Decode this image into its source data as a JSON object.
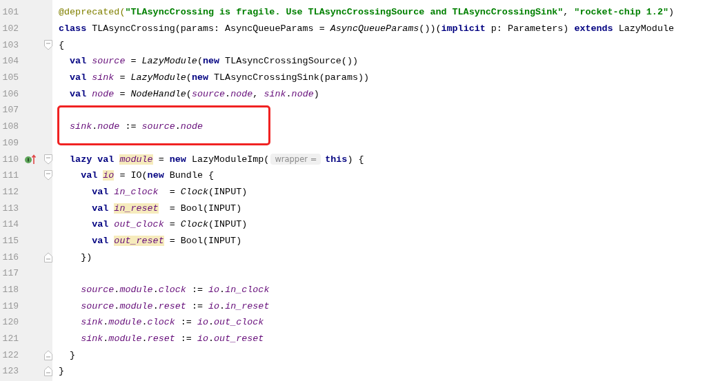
{
  "editor": {
    "lines": [
      {
        "number": "101",
        "tokens": [
          {
            "kind": "annotation",
            "text": "@deprecated("
          },
          {
            "kind": "string",
            "text": "\"TLAsyncCrossing is fragile. Use TLAsyncCrossingSource and TLAsyncCrossingSink\""
          },
          {
            "kind": "plain",
            "text": ", "
          },
          {
            "kind": "string",
            "text": "\"rocket-chip 1.2\""
          },
          {
            "kind": "plain",
            "text": ")"
          }
        ]
      },
      {
        "number": "102",
        "tokens": [
          {
            "kind": "keyword",
            "text": "class"
          },
          {
            "kind": "plain",
            "text": " TLAsyncCrossing(params: AsyncQueueParams = "
          },
          {
            "kind": "italic",
            "text": "AsyncQueueParams"
          },
          {
            "kind": "plain",
            "text": "())("
          },
          {
            "kind": "keyword",
            "text": "implicit"
          },
          {
            "kind": "plain",
            "text": " p: Parameters) "
          },
          {
            "kind": "keyword",
            "text": "extends"
          },
          {
            "kind": "plain",
            "text": " LazyModule"
          }
        ]
      },
      {
        "number": "103",
        "fold": {
          "kind": "start"
        },
        "tokens": [
          {
            "kind": "plain",
            "text": "{"
          }
        ]
      },
      {
        "number": "104",
        "tokens": [
          {
            "kind": "keyword",
            "text": "  val "
          },
          {
            "kind": "field",
            "text": "source"
          },
          {
            "kind": "plain",
            "text": " = "
          },
          {
            "kind": "italic",
            "text": "LazyModule"
          },
          {
            "kind": "plain",
            "text": "("
          },
          {
            "kind": "keyword",
            "text": "new"
          },
          {
            "kind": "plain",
            "text": " TLAsyncCrossingSource())"
          }
        ]
      },
      {
        "number": "105",
        "tokens": [
          {
            "kind": "keyword",
            "text": "  val "
          },
          {
            "kind": "field",
            "text": "sink"
          },
          {
            "kind": "plain",
            "text": " = "
          },
          {
            "kind": "italic",
            "text": "LazyModule"
          },
          {
            "kind": "plain",
            "text": "("
          },
          {
            "kind": "keyword",
            "text": "new"
          },
          {
            "kind": "plain",
            "text": " TLAsyncCrossingSink(params))"
          }
        ]
      },
      {
        "number": "106",
        "tokens": [
          {
            "kind": "keyword",
            "text": "  val "
          },
          {
            "kind": "field",
            "text": "node"
          },
          {
            "kind": "plain",
            "text": " = "
          },
          {
            "kind": "italic",
            "text": "NodeHandle"
          },
          {
            "kind": "plain",
            "text": "("
          },
          {
            "kind": "field",
            "text": "source"
          },
          {
            "kind": "plain",
            "text": "."
          },
          {
            "kind": "field",
            "text": "node"
          },
          {
            "kind": "plain",
            "text": ", "
          },
          {
            "kind": "field",
            "text": "sink"
          },
          {
            "kind": "plain",
            "text": "."
          },
          {
            "kind": "field",
            "text": "node"
          },
          {
            "kind": "plain",
            "text": ")"
          }
        ]
      },
      {
        "number": "107"
      },
      {
        "number": "108",
        "tokens": [
          {
            "kind": "field",
            "text": "  sink"
          },
          {
            "kind": "plain",
            "text": "."
          },
          {
            "kind": "field",
            "text": "node"
          },
          {
            "kind": "plain",
            "text": " := "
          },
          {
            "kind": "field",
            "text": "source"
          },
          {
            "kind": "plain",
            "text": "."
          },
          {
            "kind": "field",
            "text": "node"
          }
        ]
      },
      {
        "number": "109"
      },
      {
        "number": "110",
        "fold": {
          "kind": "start"
        },
        "gutter_mark": {
          "kind": "implements"
        },
        "tokens": [
          {
            "kind": "keyword",
            "text": "  lazy val "
          },
          {
            "kind": "field",
            "text": "module",
            "highlighted": true
          },
          {
            "kind": "plain",
            "text": " = "
          },
          {
            "kind": "keyword",
            "text": "new"
          },
          {
            "kind": "plain",
            "text": " LazyModuleImp("
          },
          {
            "kind": "hint",
            "text": "wrapper ="
          },
          {
            "kind": "keyword",
            "text": "this"
          },
          {
            "kind": "plain",
            "text": ") {"
          }
        ]
      },
      {
        "number": "111",
        "fold": {
          "kind": "start"
        },
        "tokens": [
          {
            "kind": "keyword",
            "text": "    val "
          },
          {
            "kind": "field",
            "text": "io",
            "highlighted": true
          },
          {
            "kind": "plain",
            "text": " = IO("
          },
          {
            "kind": "keyword",
            "text": "new"
          },
          {
            "kind": "plain",
            "text": " Bundle {"
          }
        ]
      },
      {
        "number": "112",
        "tokens": [
          {
            "kind": "keyword",
            "text": "      val "
          },
          {
            "kind": "field",
            "text": "in_clock"
          },
          {
            "kind": "plain",
            "text": "  = "
          },
          {
            "kind": "italic",
            "text": "Clock"
          },
          {
            "kind": "plain",
            "text": "(INPUT)"
          }
        ]
      },
      {
        "number": "113",
        "tokens": [
          {
            "kind": "keyword",
            "text": "      val "
          },
          {
            "kind": "field",
            "text": "in_reset",
            "highlighted": true
          },
          {
            "kind": "plain",
            "text": "  = Bool(INPUT)"
          }
        ]
      },
      {
        "number": "114",
        "tokens": [
          {
            "kind": "keyword",
            "text": "      val "
          },
          {
            "kind": "field",
            "text": "out_clock"
          },
          {
            "kind": "plain",
            "text": " = "
          },
          {
            "kind": "italic",
            "text": "Clock"
          },
          {
            "kind": "plain",
            "text": "(INPUT)"
          }
        ]
      },
      {
        "number": "115",
        "tokens": [
          {
            "kind": "keyword",
            "text": "      val "
          },
          {
            "kind": "field",
            "text": "out_reset",
            "highlighted": true
          },
          {
            "kind": "plain",
            "text": " = Bool(INPUT)"
          }
        ]
      },
      {
        "number": "116",
        "fold": {
          "kind": "end"
        },
        "tokens": [
          {
            "kind": "plain",
            "text": "    })"
          }
        ]
      },
      {
        "number": "117"
      },
      {
        "number": "118",
        "tokens": [
          {
            "kind": "field",
            "text": "    source"
          },
          {
            "kind": "plain",
            "text": "."
          },
          {
            "kind": "field",
            "text": "module"
          },
          {
            "kind": "plain",
            "text": "."
          },
          {
            "kind": "field",
            "text": "clock"
          },
          {
            "kind": "plain",
            "text": " := "
          },
          {
            "kind": "field",
            "text": "io"
          },
          {
            "kind": "plain",
            "text": "."
          },
          {
            "kind": "field",
            "text": "in_clock"
          }
        ]
      },
      {
        "number": "119",
        "tokens": [
          {
            "kind": "field",
            "text": "    source"
          },
          {
            "kind": "plain",
            "text": "."
          },
          {
            "kind": "field",
            "text": "module"
          },
          {
            "kind": "plain",
            "text": "."
          },
          {
            "kind": "field",
            "text": "reset"
          },
          {
            "kind": "plain",
            "text": " := "
          },
          {
            "kind": "field",
            "text": "io"
          },
          {
            "kind": "plain",
            "text": "."
          },
          {
            "kind": "field",
            "text": "in_reset"
          }
        ]
      },
      {
        "number": "120",
        "tokens": [
          {
            "kind": "field",
            "text": "    sink"
          },
          {
            "kind": "plain",
            "text": "."
          },
          {
            "kind": "field",
            "text": "module"
          },
          {
            "kind": "plain",
            "text": "."
          },
          {
            "kind": "field",
            "text": "clock"
          },
          {
            "kind": "plain",
            "text": " := "
          },
          {
            "kind": "field",
            "text": "io"
          },
          {
            "kind": "plain",
            "text": "."
          },
          {
            "kind": "field",
            "text": "out_clock"
          }
        ]
      },
      {
        "number": "121",
        "tokens": [
          {
            "kind": "field",
            "text": "    sink"
          },
          {
            "kind": "plain",
            "text": "."
          },
          {
            "kind": "field",
            "text": "module"
          },
          {
            "kind": "plain",
            "text": "."
          },
          {
            "kind": "field",
            "text": "reset"
          },
          {
            "kind": "plain",
            "text": " := "
          },
          {
            "kind": "field",
            "text": "io"
          },
          {
            "kind": "plain",
            "text": "."
          },
          {
            "kind": "field",
            "text": "out_reset"
          }
        ]
      },
      {
        "number": "122",
        "fold": {
          "kind": "end"
        },
        "tokens": [
          {
            "kind": "plain",
            "text": "  }"
          }
        ]
      },
      {
        "number": "123",
        "fold": {
          "kind": "end"
        },
        "tokens": [
          {
            "kind": "plain",
            "text": "}"
          }
        ]
      }
    ]
  }
}
